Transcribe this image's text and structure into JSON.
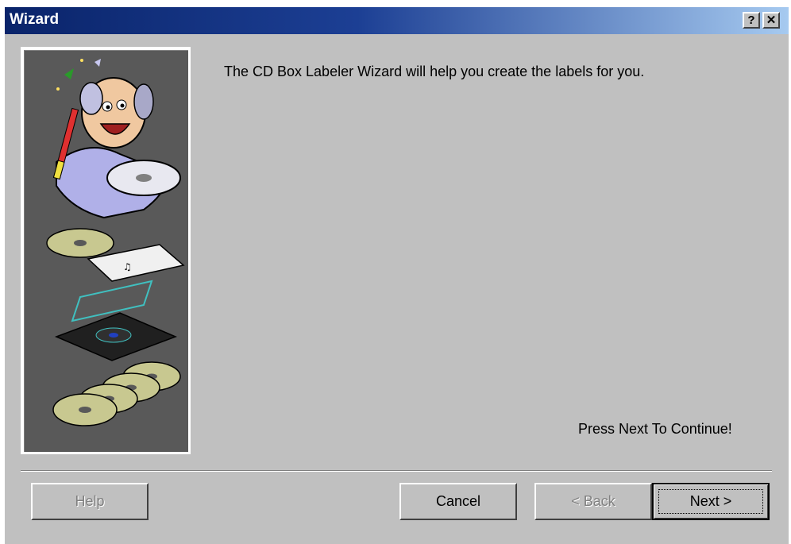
{
  "window": {
    "title": "Wizard"
  },
  "titlebar": {
    "help_glyph": "?",
    "close_glyph": "✕"
  },
  "content": {
    "intro_text": "The CD Box Labeler Wizard will help you create the labels for you.",
    "continue_text": "Press Next To Continue!"
  },
  "buttons": {
    "help": {
      "label": "Help",
      "enabled": false
    },
    "cancel": {
      "label": "Cancel",
      "enabled": true
    },
    "back": {
      "label": "< Back",
      "enabled": false
    },
    "next": {
      "label": "Next >",
      "enabled": true,
      "default": true
    }
  },
  "icons": [
    "wizard-magician-icon",
    "cd-case-icon",
    "cd-stack-icon"
  ],
  "colors": {
    "titlebar_start": "#0a246a",
    "titlebar_end": "#a6caf0",
    "dialog_bg": "#c0c0c0",
    "side_panel_bg": "#595959"
  }
}
